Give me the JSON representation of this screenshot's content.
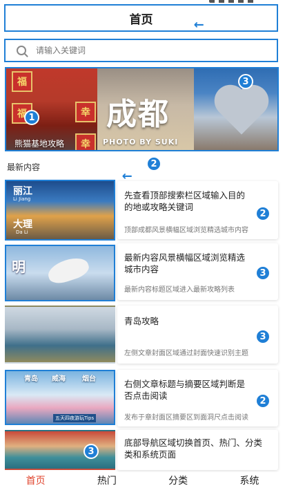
{
  "header": {
    "title": "首页"
  },
  "search": {
    "placeholder": "请输入关键词"
  },
  "banner": {
    "city": "成都",
    "photo_credit": "PHOTO BY SUKI",
    "caption": "熊猫基地攻略",
    "fu_chars": [
      "福",
      "福",
      "幸",
      "幸"
    ]
  },
  "section": {
    "title": "最新内容"
  },
  "articles": [
    {
      "title": "先查看顶部搜索栏区域输入目的的地或攻略关键词",
      "desc": "顶部成都风景横幅区域浏览精选城市内容",
      "thumb_labels": [
        "丽江",
        "Li Jiang",
        "大理",
        "Da Li"
      ]
    },
    {
      "title": "最新内容风景横幅区域浏览精选城市内容",
      "desc": "最新内容标题区域进入最新攻略列表",
      "thumb_labels": [
        "明"
      ]
    },
    {
      "title": "青岛攻略",
      "desc": "左侧文章封面区域通过封面快速识别主题",
      "thumb_labels": []
    },
    {
      "title": "右侧文章标题与摘要区域判断是否点击阅读",
      "desc": "发布于章封面区摘要区到面洞尺点击阅读",
      "thumb_labels": [
        "青岛",
        "威海",
        "烟台",
        "五天四夜游玩Tips"
      ]
    },
    {
      "title": "底部导航区域切换首页、热门、分类类和系统页面",
      "desc": "",
      "thumb_labels": []
    }
  ],
  "badges": {
    "banner_left": "1",
    "banner_right": "3",
    "section": "2",
    "a1": "2",
    "a2": "3",
    "a3": "3",
    "a4": "2",
    "a5": "3"
  },
  "tabbar": {
    "items": [
      "首页",
      "热门",
      "分类",
      "系统"
    ],
    "active": "首页"
  },
  "colors": {
    "accent": "#1f7fd6",
    "active_tab": "#e0452e"
  }
}
